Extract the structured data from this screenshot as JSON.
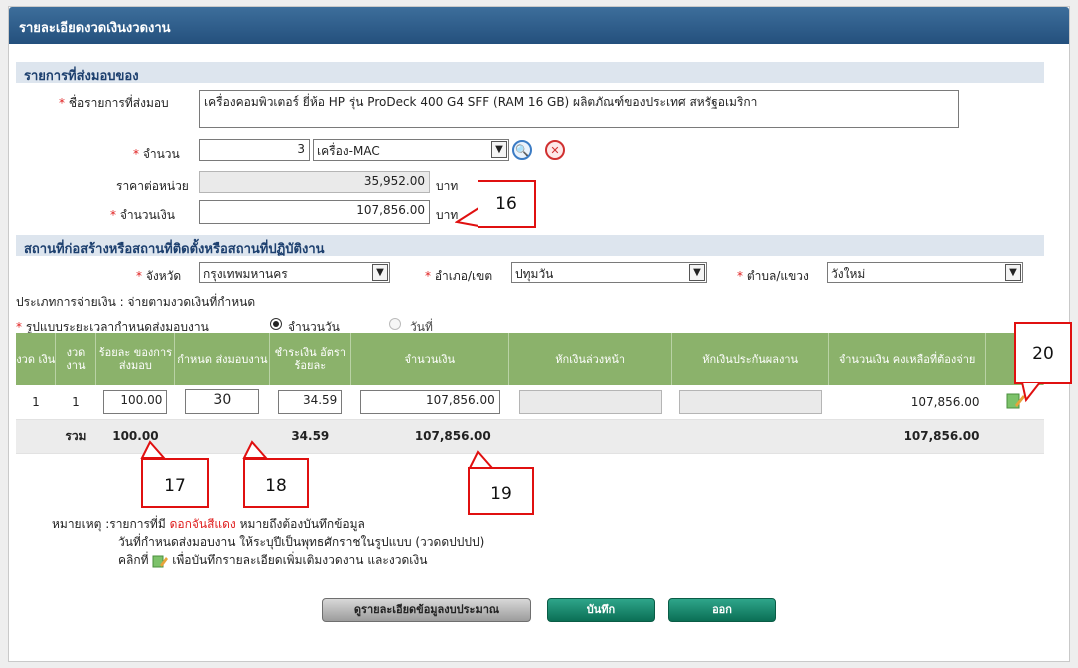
{
  "title": "รายละเอียดงวดเงินงวดงาน",
  "section_items": "รายการที่ส่งมอบของ",
  "item_name_label": "ชื่อรายการที่ส่งมอบ",
  "item_name_value": "เครื่องคอมพิวเตอร์ ยี่ห้อ HP รุ่น ProDeck 400 G4 SFF (RAM 16 GB) ผลิตภัณฑ์ของประเทศ สหรัฐอเมริกา",
  "quantity_label": "จำนวน",
  "quantity_value": "3",
  "unit_value": "เครื่อง-MAC",
  "unit_price_label": "ราคาต่อหน่วย",
  "unit_price_value": "35,952.00",
  "baht": "บาท",
  "amount_label": "จำนวนเงิน",
  "amount_value": "107,856.00",
  "section_location": "สถานที่ก่อสร้างหรือสถานที่ติดตั้งหรือสถานที่ปฏิบัติงาน",
  "province_label": "จังหวัด",
  "province_value": "กรุงเทพมหานคร",
  "district_label": "อำเภอ/เขต",
  "district_value": "ปทุมวัน",
  "subdistrict_label": "ตำบล/แขวง",
  "subdistrict_value": "วังใหม่",
  "payment_type": "ประเภทการจ่ายเงิน : จ่ายตามงวดเงินที่กำหนด",
  "delivery_format_label": "รูปแบบระยะเวลากำหนดส่งมอบงาน",
  "radio_days": "จำนวนวัน",
  "radio_date": "วันที่",
  "table": {
    "headers": [
      "งวด เงิน",
      "งวด งาน",
      "ร้อยละ ของการ ส่งมอบ",
      "กำหนด ส่งมอบงาน",
      "ชำระเงิน อัตรา ร้อยละ",
      "จำนวนเงิน",
      "หักเงินล่วงหน้า",
      "หักเงินประกันผลงาน",
      "จำนวนเงิน คงเหลือที่ต้องจ่าย"
    ],
    "row": {
      "period_money": "1",
      "period_work": "1",
      "percent": "100.00",
      "due": "30",
      "pay_rate": "34.59",
      "amount": "107,856.00",
      "remaining": "107,856.00"
    },
    "total": {
      "label": "รวม",
      "percent": "100.00",
      "pay_rate": "34.59",
      "amount": "107,856.00",
      "remaining": "107,856.00"
    }
  },
  "callouts": {
    "c16": "16",
    "c17": "17",
    "c18": "18",
    "c19": "19",
    "c20": "20"
  },
  "note": {
    "prefix": "หมายเหตุ :รายการที่มี",
    "red": "ดอกจันสีแดง",
    "suffix": "หมายถึงต้องบันทึกข้อมูล",
    "line2": "วันที่กำหนดส่งมอบงาน ให้ระบุปีเป็นพุทธศักราชในรูปแบบ (ววดดปปปป)",
    "line3a": "คลิกที่",
    "line3b": "เพื่อบันทึกรายละเอียดเพิ่มเติมงวดงาน และงวดเงิน"
  },
  "buttons": {
    "budget": "ดูรายละเอียดข้อมูลงบประมาณ",
    "save": "บันทึก",
    "exit": "ออก"
  },
  "colors": {
    "header": "#2b5887",
    "table_header": "#8bb26b",
    "required": "#e02020",
    "callout_border": "#e01010"
  }
}
